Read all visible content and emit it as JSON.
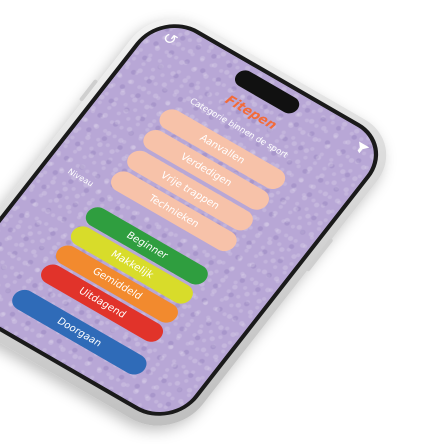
{
  "app": {
    "title": "Fitepen",
    "subtitle": "Categorie binnen de sport"
  },
  "icons": {
    "back": "back-arrow-icon",
    "filter": "filter-funnel-icon"
  },
  "categories": [
    {
      "label": "Aanvallen"
    },
    {
      "label": "Verdedigen"
    },
    {
      "label": "Vrije trappen"
    },
    {
      "label": "Technieken"
    }
  ],
  "niveau": {
    "label": "Niveau",
    "levels": [
      {
        "label": "Beginner",
        "color": "#2f9e3f"
      },
      {
        "label": "Makkelijk",
        "color": "#d8dc2a"
      },
      {
        "label": "Gemiddeld",
        "color": "#f28a2e"
      },
      {
        "label": "Uitdagend",
        "color": "#e1332a"
      }
    ]
  },
  "actions": {
    "continue_label": "Doorgaan",
    "continue_color": "#2f6bb8"
  },
  "theme": {
    "screen_bg": "#b8a7d6",
    "accent": "#f26b3a",
    "category_bg": "#f7c2a9"
  }
}
